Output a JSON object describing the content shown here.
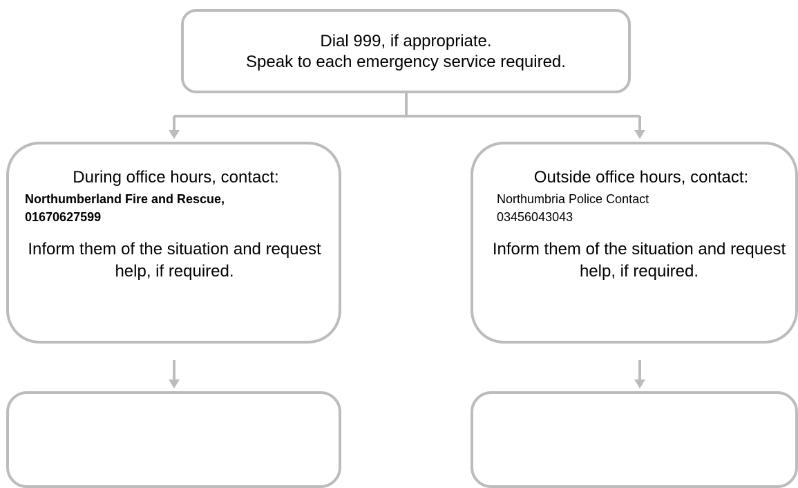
{
  "top_box": {
    "line1": "Dial 999, if appropriate.",
    "line2": "Speak to each emergency service required."
  },
  "left_box": {
    "heading": "During office hours, contact:",
    "contact": "Northumberland Fire and Rescue, 01670627599",
    "instruction": "Inform them of the situation and request help, if required."
  },
  "right_box": {
    "heading": "Outside office hours, contact:",
    "contact": "Northumbria Police Contact 03456043043",
    "instruction": "Inform them of the situation and request help, if required."
  },
  "colors": {
    "border": "#bcbcbc",
    "connector": "#bcbcbc",
    "text": "#000000",
    "background": "#ffffff"
  }
}
